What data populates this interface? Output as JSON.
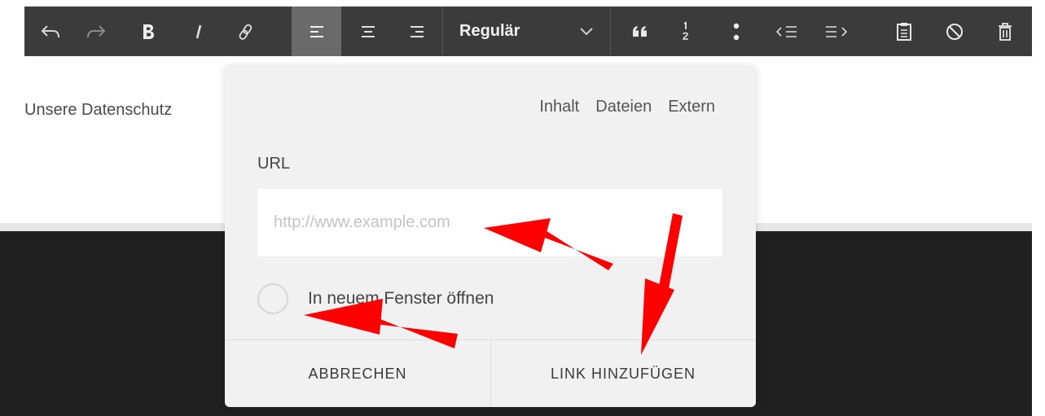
{
  "toolbar": {
    "buttons": [
      {
        "name": "undo-icon"
      },
      {
        "name": "redo-icon"
      },
      {
        "name": "bold-icon"
      },
      {
        "name": "italic-icon"
      },
      {
        "name": "link-icon"
      },
      {
        "name": "align-left-icon",
        "active": true
      },
      {
        "name": "align-center-icon"
      },
      {
        "name": "align-right-icon"
      },
      {
        "name": "quote-icon"
      },
      {
        "name": "numbered-list-icon"
      },
      {
        "name": "bullet-list-icon"
      },
      {
        "name": "outdent-icon"
      },
      {
        "name": "indent-icon"
      },
      {
        "name": "paste-icon"
      },
      {
        "name": "clear-format-icon"
      },
      {
        "name": "trash-icon"
      }
    ],
    "style_select": {
      "value": "Regulär"
    },
    "colors": {
      "background": "#3b3b3b",
      "active": "#6a6a6a",
      "icon": "#e8e8e8"
    }
  },
  "page": {
    "text": "Unsere Datenschutz"
  },
  "link_dialog": {
    "tabs": [
      "Inhalt",
      "Dateien",
      "Extern"
    ],
    "url_label": "URL",
    "url_placeholder": "http://www.example.com",
    "url_value": "",
    "new_window_label": "In neuem Fenster öffnen",
    "new_window_checked": false,
    "cancel_label": "ABBRECHEN",
    "add_label": "LINK HINZUFÜGEN"
  },
  "annotations": {
    "arrow_color": "#ff0000"
  }
}
